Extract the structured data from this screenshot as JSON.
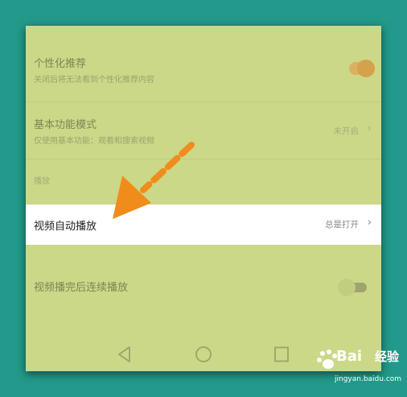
{
  "settings": {
    "personalized": {
      "title": "个性化推荐",
      "subtitle": "关闭后将无法看到个性化推荐内容",
      "enabled": true
    },
    "basic_mode": {
      "title": "基本功能模式",
      "subtitle": "仅使用基本功能：观看和搜索视频",
      "value": "未开启"
    },
    "section_play": "播放",
    "autoplay": {
      "title": "视频自动播放",
      "value": "总是打开"
    },
    "continuous": {
      "title": "视频播完后连续播放",
      "enabled": false
    }
  },
  "watermark": {
    "brand": "Bai",
    "brand_suffix": "经验",
    "url": "jingyan.baidu.com"
  },
  "colors": {
    "background": "#22998a",
    "overlay": "#cbd888",
    "toggle_on": "#d5a14c",
    "arrow": "#f08c1c"
  }
}
